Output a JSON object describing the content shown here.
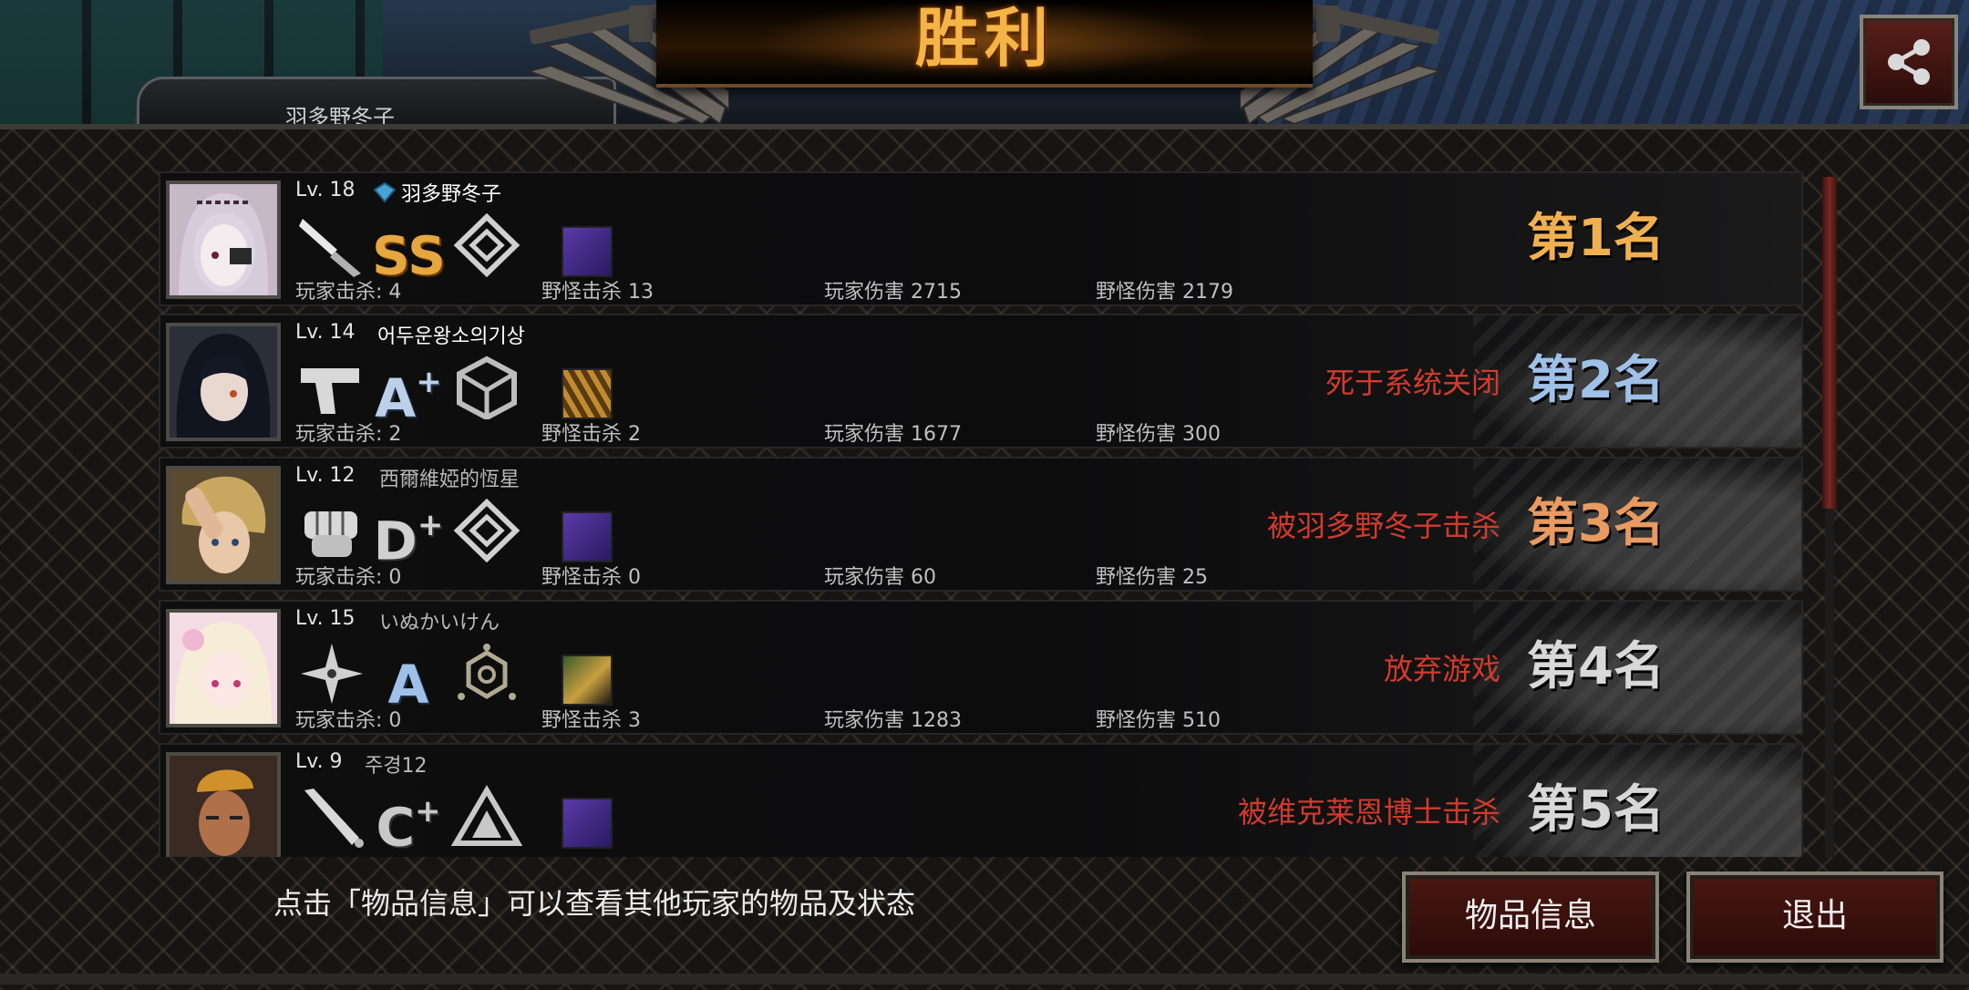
{
  "header": {
    "title": "胜利",
    "mini_status_text": "羽多野冬子"
  },
  "hint": "点击「物品信息」可以查看其他玩家的物品及状态",
  "buttons": {
    "item_info": "物品信息",
    "exit": "退出"
  },
  "colors": {
    "title_gold": "#f5b446",
    "death_red": "#d33a2c",
    "button_red": "#4a1712",
    "rank1": "#f0b050",
    "rank2": "#9fc0e8",
    "rank3": "#e89a60",
    "rank_other": "#d8d8d8"
  },
  "players": [
    {
      "level": "Lv. 18",
      "name": "羽多野冬子",
      "has_badge": true,
      "weapon_icon": "knife-icon",
      "grade": "SS",
      "grade_plus": "",
      "rank_emblem": "diamond-emblem-icon",
      "kills_label": "玩家击杀: 4",
      "monster_kills_label": "野怪击杀 13",
      "player_damage_label": "玩家伤害 2715",
      "monster_damage_label": "野怪伤害 2179",
      "death_reason": "",
      "placement": "第1名"
    },
    {
      "level": "Lv. 14",
      "name": "어두운왕소의기상",
      "has_badge": false,
      "weapon_icon": "pistol-icon",
      "grade": "A",
      "grade_plus": "+",
      "rank_emblem": "cube-emblem-icon",
      "kills_label": "玩家击杀: 2",
      "monster_kills_label": "野怪击杀 2",
      "player_damage_label": "玩家伤害 1677",
      "monster_damage_label": "野怪伤害 300",
      "death_reason": "死于系统关闭",
      "placement": "第2名"
    },
    {
      "level": "Lv. 12",
      "name": "西爾維婭的恆星",
      "has_badge": false,
      "weapon_icon": "fist-icon",
      "grade": "D",
      "grade_plus": "+",
      "rank_emblem": "diamond-emblem-icon",
      "kills_label": "玩家击杀: 0",
      "monster_kills_label": "野怪击杀 0",
      "player_damage_label": "玩家伤害 60",
      "monster_damage_label": "野怪伤害 25",
      "death_reason": "被羽多野冬子击杀",
      "placement": "第3名"
    },
    {
      "level": "Lv. 15",
      "name": "いぬかいけん",
      "has_badge": false,
      "weapon_icon": "shuriken-icon",
      "grade": "A",
      "grade_plus": "",
      "rank_emblem": "hexagon-emblem-icon",
      "kills_label": "玩家击杀: 0",
      "monster_kills_label": "野怪击杀 3",
      "player_damage_label": "玩家伤害 1283",
      "monster_damage_label": "野怪伤害 510",
      "death_reason": "放弃游戏",
      "placement": "第4名"
    },
    {
      "level": "Lv. 9",
      "name": "주경12",
      "has_badge": false,
      "weapon_icon": "bat-icon",
      "grade": "C",
      "grade_plus": "+",
      "rank_emblem": "triangle-emblem-icon",
      "kills_label": "",
      "monster_kills_label": "",
      "player_damage_label": "",
      "monster_damage_label": "",
      "death_reason": "被维克莱恩博士击杀",
      "placement": "第5名"
    }
  ]
}
